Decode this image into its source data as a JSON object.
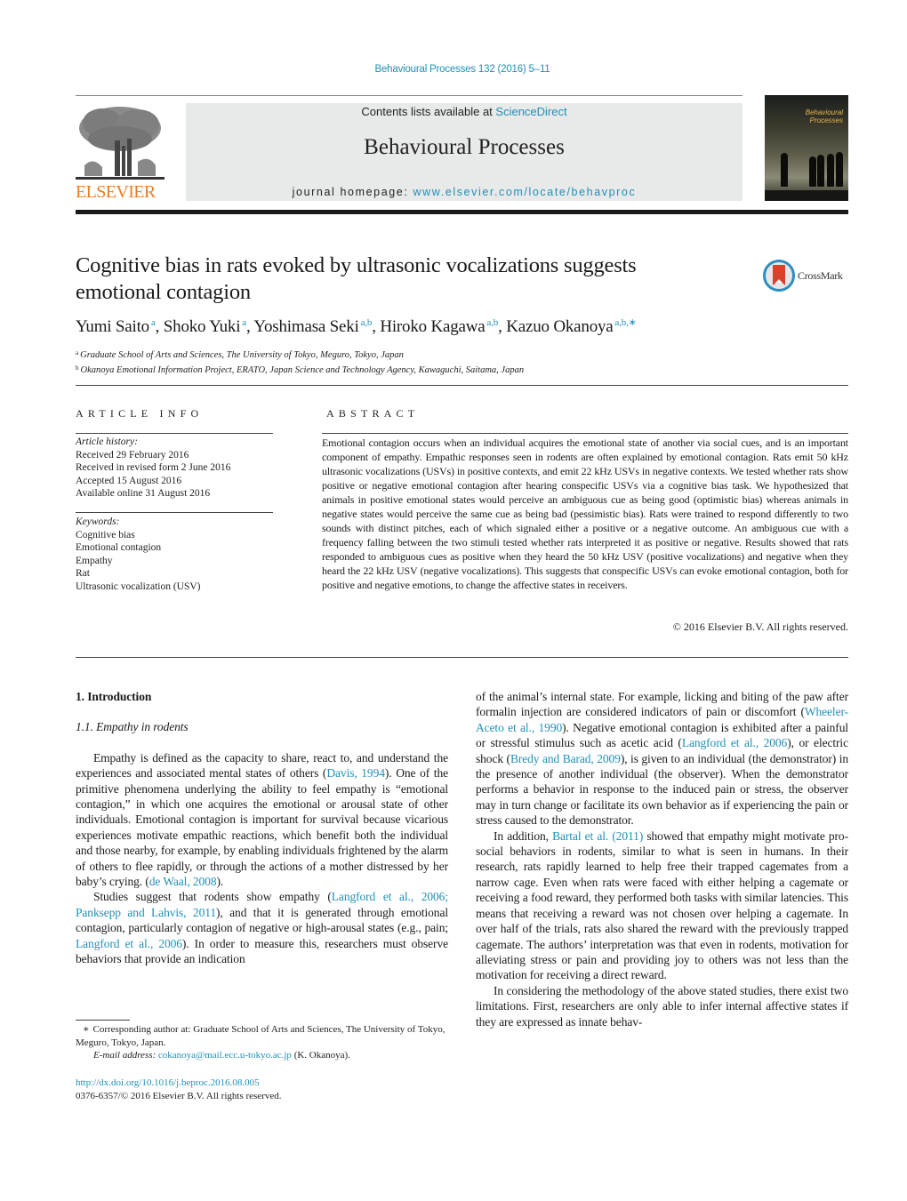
{
  "journal_ref": "Behavioural Processes 132 (2016) 5–11",
  "publisher": {
    "name": "ELSEVIER",
    "brand_color": "#ef7d1c"
  },
  "masthead": {
    "contents_prefix": "Contents lists available at ",
    "contents_link": "ScienceDirect",
    "journal_title": "Behavioural Processes",
    "homepage_prefix": "journal homepage: ",
    "homepage_link": "www.elsevier.com/locate/behavproc"
  },
  "cover": {
    "title_line1": "Behavioural",
    "title_line2": "Processes"
  },
  "crossmark_label": "CrossMark",
  "link_color": "#1f8fb8",
  "article": {
    "title": "Cognitive bias in rats evoked by ultrasonic vocalizations suggests emotional contagion",
    "authors": [
      {
        "name": "Yumi Saito",
        "aff": "a"
      },
      {
        "name": "Shoko Yuki",
        "aff": "a"
      },
      {
        "name": "Yoshimasa Seki",
        "aff": "a,b"
      },
      {
        "name": "Hiroko Kagawa",
        "aff": "a,b"
      },
      {
        "name": "Kazuo Okanoya",
        "aff": "a,b,∗"
      }
    ],
    "affiliations": [
      {
        "mark": "a",
        "text": "Graduate School of Arts and Sciences, The University of Tokyo, Meguro, Tokyo, Japan"
      },
      {
        "mark": "b",
        "text": "Okanoya Emotional Information Project, ERATO, Japan Science and Technology Agency, Kawaguchi, Saitama, Japan"
      }
    ]
  },
  "article_info": {
    "heading": "ARTICLE INFO",
    "history_label": "Article history:",
    "history": [
      "Received 29 February 2016",
      "Received in revised form 2 June 2016",
      "Accepted 15 August 2016",
      "Available online 31 August 2016"
    ],
    "keywords_label": "Keywords:",
    "keywords": [
      "Cognitive bias",
      "Emotional contagion",
      "Empathy",
      "Rat",
      "Ultrasonic vocalization (USV)"
    ]
  },
  "abstract": {
    "heading": "ABSTRACT",
    "text": "Emotional contagion occurs when an individual acquires the emotional state of another via social cues, and is an important component of empathy. Empathic responses seen in rodents are often explained by emotional contagion. Rats emit 50 kHz ultrasonic vocalizations (USVs) in positive contexts, and emit 22 kHz USVs in negative contexts. We tested whether rats show positive or negative emotional contagion after hearing conspecific USVs via a cognitive bias task. We hypothesized that animals in positive emotional states would perceive an ambiguous cue as being good (optimistic bias) whereas animals in negative states would perceive the same cue as being bad (pessimistic bias). Rats were trained to respond differently to two sounds with distinct pitches, each of which signaled either a positive or a negative outcome. An ambiguous cue with a frequency falling between the two stimuli tested whether rats interpreted it as positive or negative. Results showed that rats responded to ambiguous cues as positive when they heard the 50 kHz USV (positive vocalizations) and negative when they heard the 22 kHz USV (negative vocalizations). This suggests that conspecific USVs can evoke emotional contagion, both for positive and negative emotions, to change the affective states in receivers.",
    "copyright": "© 2016 Elsevier B.V. All rights reserved."
  },
  "body": {
    "section_heading": "1.  Introduction",
    "subsection_heading": "1.1.  Empathy in rodents",
    "left_paragraphs": [
      [
        {
          "t": "Empathy is defined as the capacity to share, react to, and understand the experiences and associated mental states of others ("
        },
        {
          "t": "Davis, 1994",
          "link": true
        },
        {
          "t": "). One of the primitive phenomena underlying the ability to feel empathy is “emotional contagion,” in which one acquires the emotional or arousal state of other individuals. Emotional contagion is important for survival because vicarious experiences motivate empathic reactions, which benefit both the individual and those nearby, for example, by enabling individuals frightened by the alarm of others to flee rapidly, or through the actions of a mother distressed by her baby’s crying. ("
        },
        {
          "t": "de Waal, 2008",
          "link": true
        },
        {
          "t": ")."
        }
      ],
      [
        {
          "t": "Studies suggest that rodents show empathy ("
        },
        {
          "t": "Langford et al., 2006; Panksepp and Lahvis, 2011",
          "link": true
        },
        {
          "t": "), and that it is generated through emotional contagion, particularly contagion of negative or high-arousal states (e.g., pain; "
        },
        {
          "t": "Langford et al., 2006",
          "link": true
        },
        {
          "t": "). In order to measure this, researchers must observe behaviors that provide an indication"
        }
      ]
    ],
    "right_paragraphs": [
      [
        {
          "t": "of the animal’s internal state. For example, licking and biting of the paw after formalin injection are considered indicators of pain or discomfort ("
        },
        {
          "t": "Wheeler-Aceto et al., 1990",
          "link": true
        },
        {
          "t": "). Negative emotional contagion is exhibited after a painful or stressful stimulus such as acetic acid ("
        },
        {
          "t": "Langford et al., 2006",
          "link": true
        },
        {
          "t": "), or electric shock ("
        },
        {
          "t": "Bredy and Barad, 2009",
          "link": true
        },
        {
          "t": "), is given to an individual (the demonstrator) in the presence of another individual (the observer). When the demonstrator performs a behavior in response to the induced pain or stress, the observer may in turn change or facilitate its own behavior as if experiencing the pain or stress caused to the demonstrator."
        }
      ],
      [
        {
          "t": "In addition, "
        },
        {
          "t": "Bartal et al. (2011)",
          "link": true
        },
        {
          "t": " showed that empathy might motivate pro-social behaviors in rodents, similar to what is seen in humans. In their research, rats rapidly learned to help free their trapped cagemates from a narrow cage. Even when rats were faced with either helping a cagemate or receiving a food reward, they performed both tasks with similar latencies. This means that receiving a reward was not chosen over helping a cagemate. In over half of the trials, rats also shared the reward with the previously trapped cagemate. The authors’ interpretation was that even in rodents, motivation for alleviating stress or pain and providing joy to others was not less than the motivation for receiving a direct reward."
        }
      ],
      [
        {
          "t": "In considering the methodology of the above stated studies, there exist two limitations. First, researchers are only able to infer internal affective states if they are expressed as innate behav-"
        }
      ]
    ]
  },
  "footnotes": {
    "corresponding_mark": "∗",
    "corresponding_text": "Corresponding author at: Graduate School of Arts and Sciences, The University of Tokyo, Meguro, Tokyo, Japan.",
    "email_label": "E-mail address:",
    "email": "cokanoya@mail.ecc.u-tokyo.ac.jp",
    "email_suffix": " (K. Okanoya).",
    "doi": "http://dx.doi.org/10.1016/j.beproc.2016.08.005",
    "issn_copyright": "0376-6357/© 2016 Elsevier B.V. All rights reserved."
  }
}
